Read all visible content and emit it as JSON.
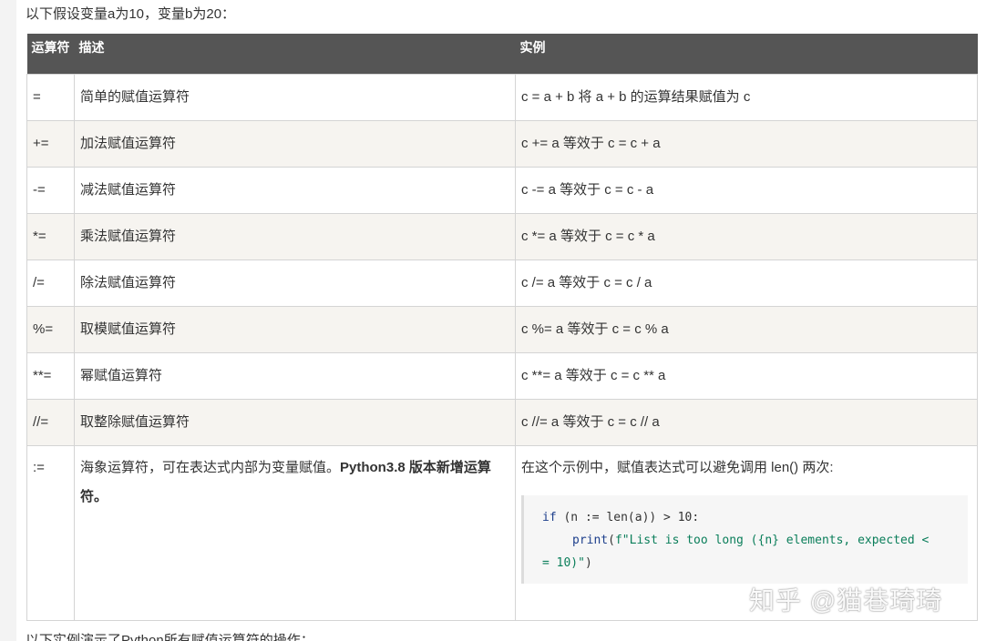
{
  "intro": "以下假设变量a为10，变量b为20：",
  "headers": {
    "op": "运算符",
    "desc": "描述",
    "example": "实例"
  },
  "rows": [
    {
      "op": "=",
      "desc": "简单的赋值运算符",
      "example": "c = a + b 将 a + b 的运算结果赋值为 c"
    },
    {
      "op": "+=",
      "desc": "加法赋值运算符",
      "example": "c += a 等效于 c = c + a"
    },
    {
      "op": "-=",
      "desc": "减法赋值运算符",
      "example": "c -= a 等效于 c = c - a"
    },
    {
      "op": "*=",
      "desc": "乘法赋值运算符",
      "example": "c *= a 等效于 c = c * a"
    },
    {
      "op": "/=",
      "desc": "除法赋值运算符",
      "example": "c /= a 等效于 c = c / a"
    },
    {
      "op": "%=",
      "desc": "取模赋值运算符",
      "example": "c %= a 等效于 c = c % a"
    },
    {
      "op": "**=",
      "desc": "幂赋值运算符",
      "example": "c **= a 等效于 c = c ** a"
    },
    {
      "op": "//=",
      "desc": "取整除赋值运算符",
      "example": "c //= a 等效于 c = c // a"
    }
  ],
  "walrus": {
    "op": ":=",
    "desc_plain": "海象运算符，可在表达式内部为变量赋值。",
    "desc_bold": "Python3.8 版本新增运算符。",
    "example_text": "在这个示例中，赋值表达式可以避免调用 len() 两次:",
    "code": {
      "line1_kw": "if",
      "line1_rest": " (n := len(a)) > 10:",
      "line2_kw": "print",
      "line2_open": "(",
      "line2_str_a": "f\"List is too long ({n} elements, expected <",
      "line3_str": "= 10)\"",
      "line3_close": ")"
    }
  },
  "watermark": "知乎 @猫巷琦琦",
  "footer": "以下实例演示了Python所有赋值运算符的操作："
}
